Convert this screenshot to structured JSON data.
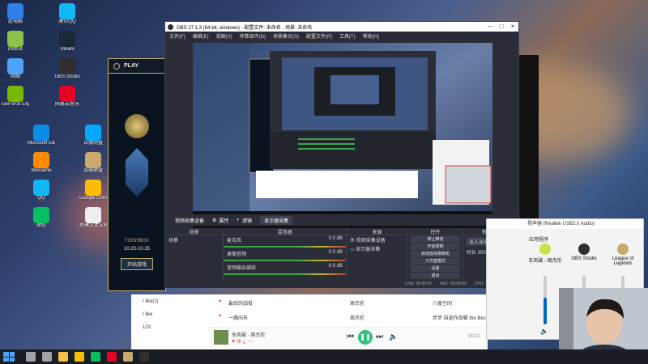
{
  "desktop": {
    "icons": [
      {
        "label": "此电脑",
        "color": "#2f80ed"
      },
      {
        "label": "回收站",
        "color": "#8bc34a"
      },
      {
        "label": "网络",
        "color": "#4da3ff"
      },
      {
        "label": "GeForce Experience",
        "color": "#76b900"
      },
      {
        "label": "Microsoft Edge",
        "color": "#0c8ce9"
      },
      {
        "label": "WeGame",
        "color": "#ff8c00"
      },
      {
        "label": "QQ",
        "color": "#12b7f5"
      },
      {
        "label": "微信",
        "color": "#07c160"
      },
      {
        "label": "腾讯QQ",
        "color": "#12b7f5"
      },
      {
        "label": "Steam",
        "color": "#1b2838"
      },
      {
        "label": "OBS Studio",
        "color": "#302e31"
      },
      {
        "label": "网易云音乐",
        "color": "#e60026"
      },
      {
        "label": "百度网盘",
        "color": "#06a7ff"
      },
      {
        "label": "英雄联盟",
        "color": "#c8aa6e"
      },
      {
        "label": "Google Chrome",
        "color": "#fbbc05"
      },
      {
        "label": "新建文本文档",
        "color": "#eeeeee"
      }
    ]
  },
  "lol_client": {
    "play_label": "PLAY",
    "rank_badge": "TOGHBOX",
    "date_range": "10.20-10.25",
    "button_label": "开始游戏"
  },
  "obs": {
    "title": "OBS 27.1.3 (64-bit, windows) - 配置文件: 未命名 - 场景: 未命名",
    "menu": [
      "文件(F)",
      "编辑(E)",
      "视图(V)",
      "停靠部件(D)",
      "场景集合(S)",
      "配置文件(P)",
      "工具(T)",
      "帮助(H)"
    ],
    "props_bar": [
      "属性",
      "滤镜",
      "显示器采集"
    ],
    "source_label": "视频采集设备",
    "docks": {
      "scenes": {
        "title": "场景",
        "items": [
          "场景"
        ]
      },
      "sources": {
        "title": "来源",
        "items": [
          "视频采集设备",
          "显示器采集"
        ]
      },
      "mixer": {
        "title": "混音器",
        "tracks": [
          {
            "name": "麦克风",
            "level": "0.0 dB"
          },
          {
            "name": "桌面音频",
            "level": "0.0 dB"
          },
          {
            "name": "音频输出捕获",
            "level": "0.0 dB"
          }
        ]
      },
      "transitions": {
        "title": "转场特效",
        "type": "淡入淡出",
        "duration_label": "时长",
        "duration": "300 ms"
      },
      "controls": {
        "title": "控件",
        "buttons": [
          "停止推流",
          "开始录制",
          "启动虚拟摄像机",
          "工作室模式",
          "设置",
          "退出"
        ]
      }
    },
    "status": {
      "live": "LIVE: 00:00:00",
      "rec": "REC: 00:00:00",
      "cpu": "CPU: 1.3%, 60.00 fps"
    }
  },
  "music": {
    "rows": [
      {
        "title": "最后的战役",
        "artist": "周杰伦",
        "album": "八度空间"
      },
      {
        "title": "一路向东",
        "artist": "周杰伦",
        "album": "步步 自选作品辑 the Best"
      }
    ],
    "sidebar": [
      "I like(1)",
      "I like",
      "123"
    ],
    "now_playing": {
      "song": "东风破 - 周杰伦",
      "time": "00:22"
    }
  },
  "audio_mixer": {
    "title": "扬声器 (Realtek USB2.0 Audio)",
    "section": "应用程序",
    "apps": [
      {
        "name": "东风破 - 周杰伦",
        "color": "#c8e04b",
        "level": 0.55
      },
      {
        "name": "OBS Studio",
        "color": "#302e31",
        "level": 0.65
      },
      {
        "name": "League of Legends",
        "color": "#c8aa6e",
        "level": 0.7
      }
    ]
  },
  "taskbar": {
    "apps": [
      {
        "name": "search-icon",
        "color": "#ffffff"
      },
      {
        "name": "task-view-icon",
        "color": "#ffffff"
      },
      {
        "name": "file-explorer-icon",
        "color": "#f6c343"
      },
      {
        "name": "chrome-icon",
        "color": "#fbbc05"
      },
      {
        "name": "wechat-icon",
        "color": "#07c160"
      },
      {
        "name": "music-icon",
        "color": "#e60026"
      },
      {
        "name": "lol-icon",
        "color": "#c8aa6e"
      },
      {
        "name": "obs-icon",
        "color": "#302e31"
      }
    ]
  }
}
